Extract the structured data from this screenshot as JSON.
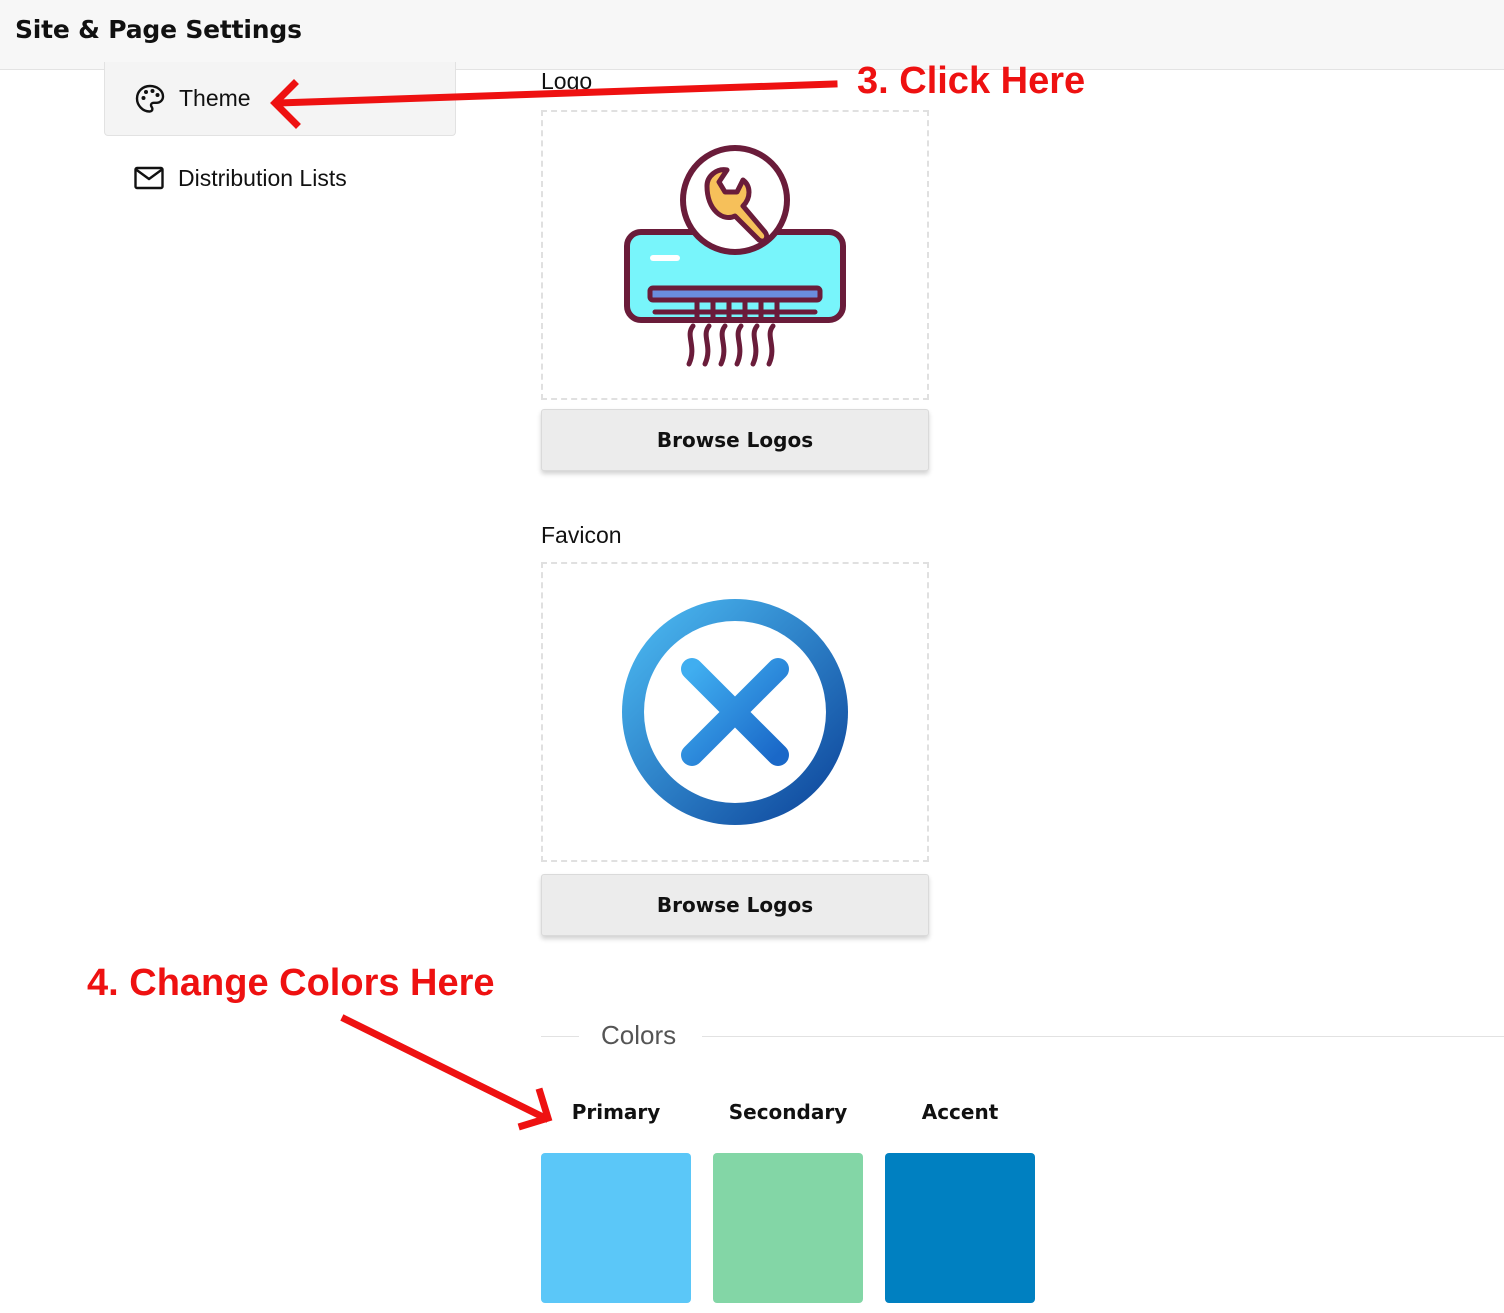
{
  "header": {
    "title": "Site & Page Settings"
  },
  "sidebar": {
    "items": [
      {
        "label": "Theme",
        "icon": "palette-icon",
        "selected": true
      },
      {
        "label": "Distribution Lists",
        "icon": "mail-icon",
        "selected": false
      }
    ]
  },
  "logo_section": {
    "label": "Logo",
    "image": "air-conditioner-wrench-logo",
    "button_label": "Browse Logos"
  },
  "favicon_section": {
    "label": "Favicon",
    "image": "snowflake-circle-favicon",
    "button_label": "Browse Logos"
  },
  "colors_section": {
    "heading": "Colors",
    "swatches": [
      {
        "label": "Primary",
        "color": "#5bc7f8"
      },
      {
        "label": "Secondary",
        "color": "#83d6a6"
      },
      {
        "label": "Accent",
        "color": "#0080c1"
      }
    ]
  },
  "annotations": {
    "step3": "3. Click Here",
    "step4": "4. Change Colors Here",
    "color": "#ee1111"
  }
}
